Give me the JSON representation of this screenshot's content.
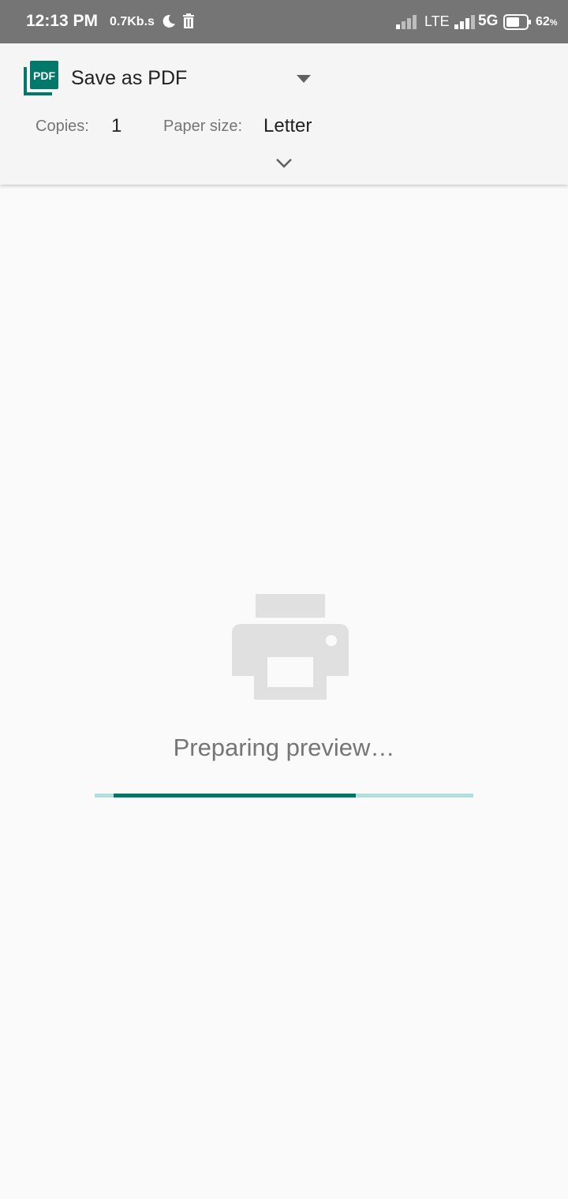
{
  "status_bar": {
    "time": "12:13 PM",
    "net_speed": "0.7Kb.s",
    "network_1": "LTE",
    "network_2": "5G",
    "battery": "62",
    "battery_unit": "%",
    "icons": [
      "moon-icon",
      "trash-icon",
      "signal-icon",
      "signal-icon",
      "battery-icon"
    ]
  },
  "header": {
    "printer_name": "Save as PDF",
    "pdf_icon_text": "PDF",
    "copies_label": "Copies:",
    "copies_value": "1",
    "paper_size_label": "Paper size:",
    "paper_size_value": "Letter"
  },
  "preview": {
    "message": "Preparing preview…",
    "progress": {
      "start": 0.05,
      "end": 0.69
    }
  },
  "colors": {
    "accent": "#00796b",
    "accent_light": "#b2dfdb",
    "status_bar": "#757575",
    "placeholder_gray": "#e0e0e0"
  }
}
